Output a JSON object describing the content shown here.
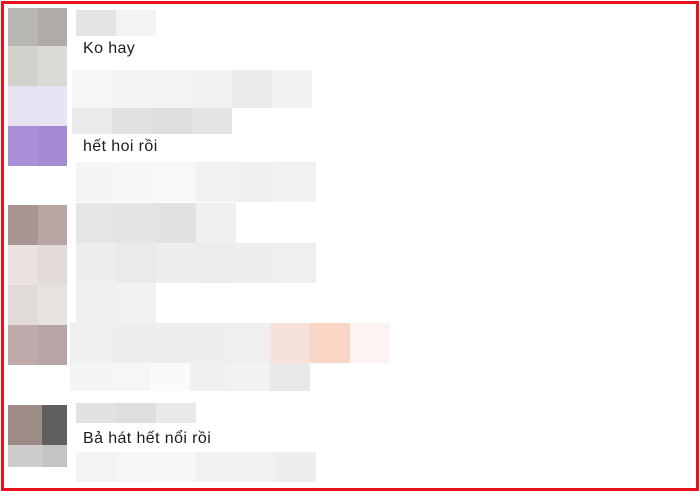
{
  "frame": {
    "border_color": "#e8121b"
  },
  "comments": [
    {
      "text": "Ko hay"
    },
    {
      "text": "hết hoi rồi"
    },
    {
      "text": "Bả hát hết nổi rồi"
    }
  ]
}
